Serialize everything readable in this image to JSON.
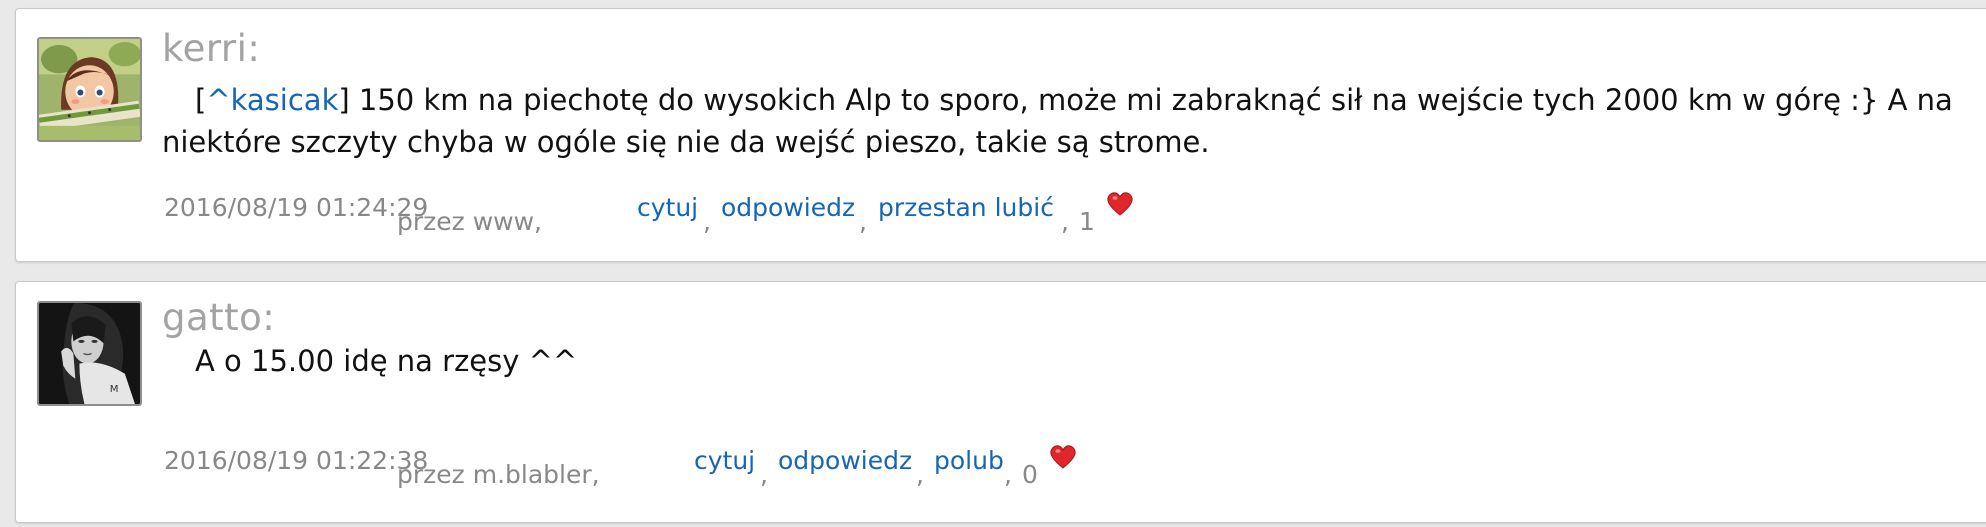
{
  "posts": [
    {
      "author": "kerri:",
      "quote_open": "[",
      "mention": "^kasicak",
      "text": "] 150 km na piechotę do wysokich Alp to sporo, może mi zabraknąć sił na wejście tych 2000 km w górę :} A na niektóre szczyty chyba w ogóle się nie da wejść pieszo, takie są strome.",
      "date": "2016/08/19 01:24:29",
      "via": "przez www,",
      "actions": [
        "cytuj",
        "odpowiedz",
        "przestan lubić"
      ],
      "likes": "1",
      "heart_color": "#e0262b"
    },
    {
      "author": "gatto:",
      "text": "A o 15.00 idę na rzęsy ^^",
      "date": "2016/08/19 01:22:38",
      "via": "przez m.blabler,",
      "actions": [
        "cytuj",
        "odpowiedz",
        "polub"
      ],
      "likes": "0",
      "heart_color": "#e0262b"
    }
  ],
  "separators": {
    "comma": ",",
    "comma_space": ", "
  },
  "icons": {
    "heart": "heart-icon",
    "avatar1": "avatar-cartoon-girl",
    "avatar2": "avatar-bw-photo"
  }
}
